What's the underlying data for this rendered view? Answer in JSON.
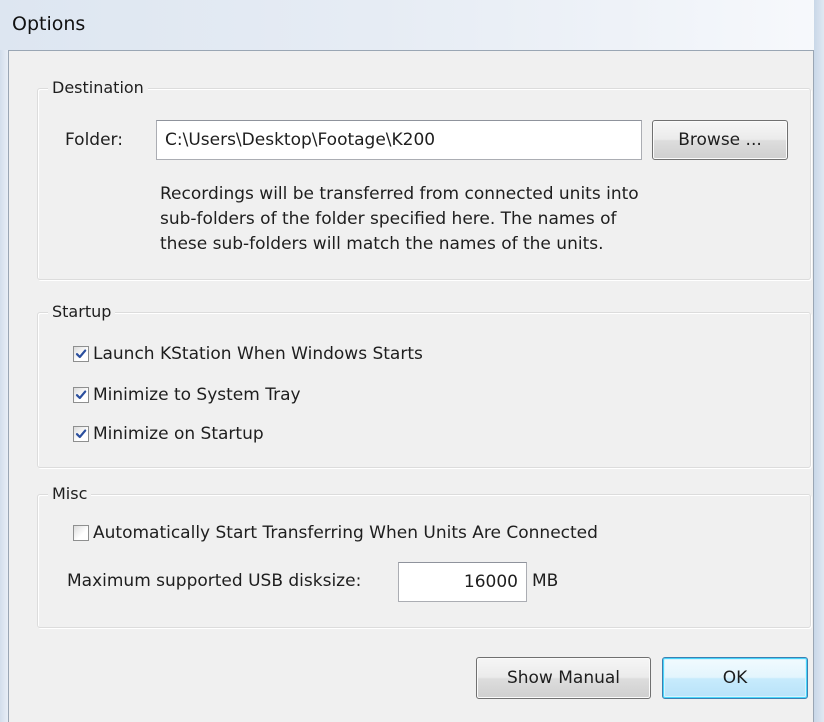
{
  "window": {
    "title": "Options"
  },
  "destination": {
    "group_label": "Destination",
    "folder_label": "Folder:",
    "folder_value": "C:\\Users\\Desktop\\Footage\\K200",
    "browse_label": "Browse ...",
    "description_lines": [
      "Recordings will be transferred from connected units into",
      "sub-folders of the folder specified here. The names of",
      "these sub-folders will match the names of the units."
    ]
  },
  "startup": {
    "group_label": "Startup",
    "options": [
      {
        "label": "Launch KStation When Windows Starts",
        "checked": true
      },
      {
        "label": "Minimize to System Tray",
        "checked": true
      },
      {
        "label": "Minimize on Startup",
        "checked": true
      }
    ]
  },
  "misc": {
    "group_label": "Misc",
    "auto_transfer": {
      "label": "Automatically Start Transferring When Units Are Connected",
      "checked": false
    },
    "disksize_label": "Maximum supported USB disksize:",
    "disksize_value": "16000",
    "disksize_unit": "MB"
  },
  "footer": {
    "show_manual_label": "Show Manual",
    "ok_label": "OK"
  },
  "colors": {
    "check_mark": "#2b4f9e",
    "default_button_border": "#3c7fb1"
  },
  "icons": {
    "checkbox_checked": "check-mark-icon"
  }
}
